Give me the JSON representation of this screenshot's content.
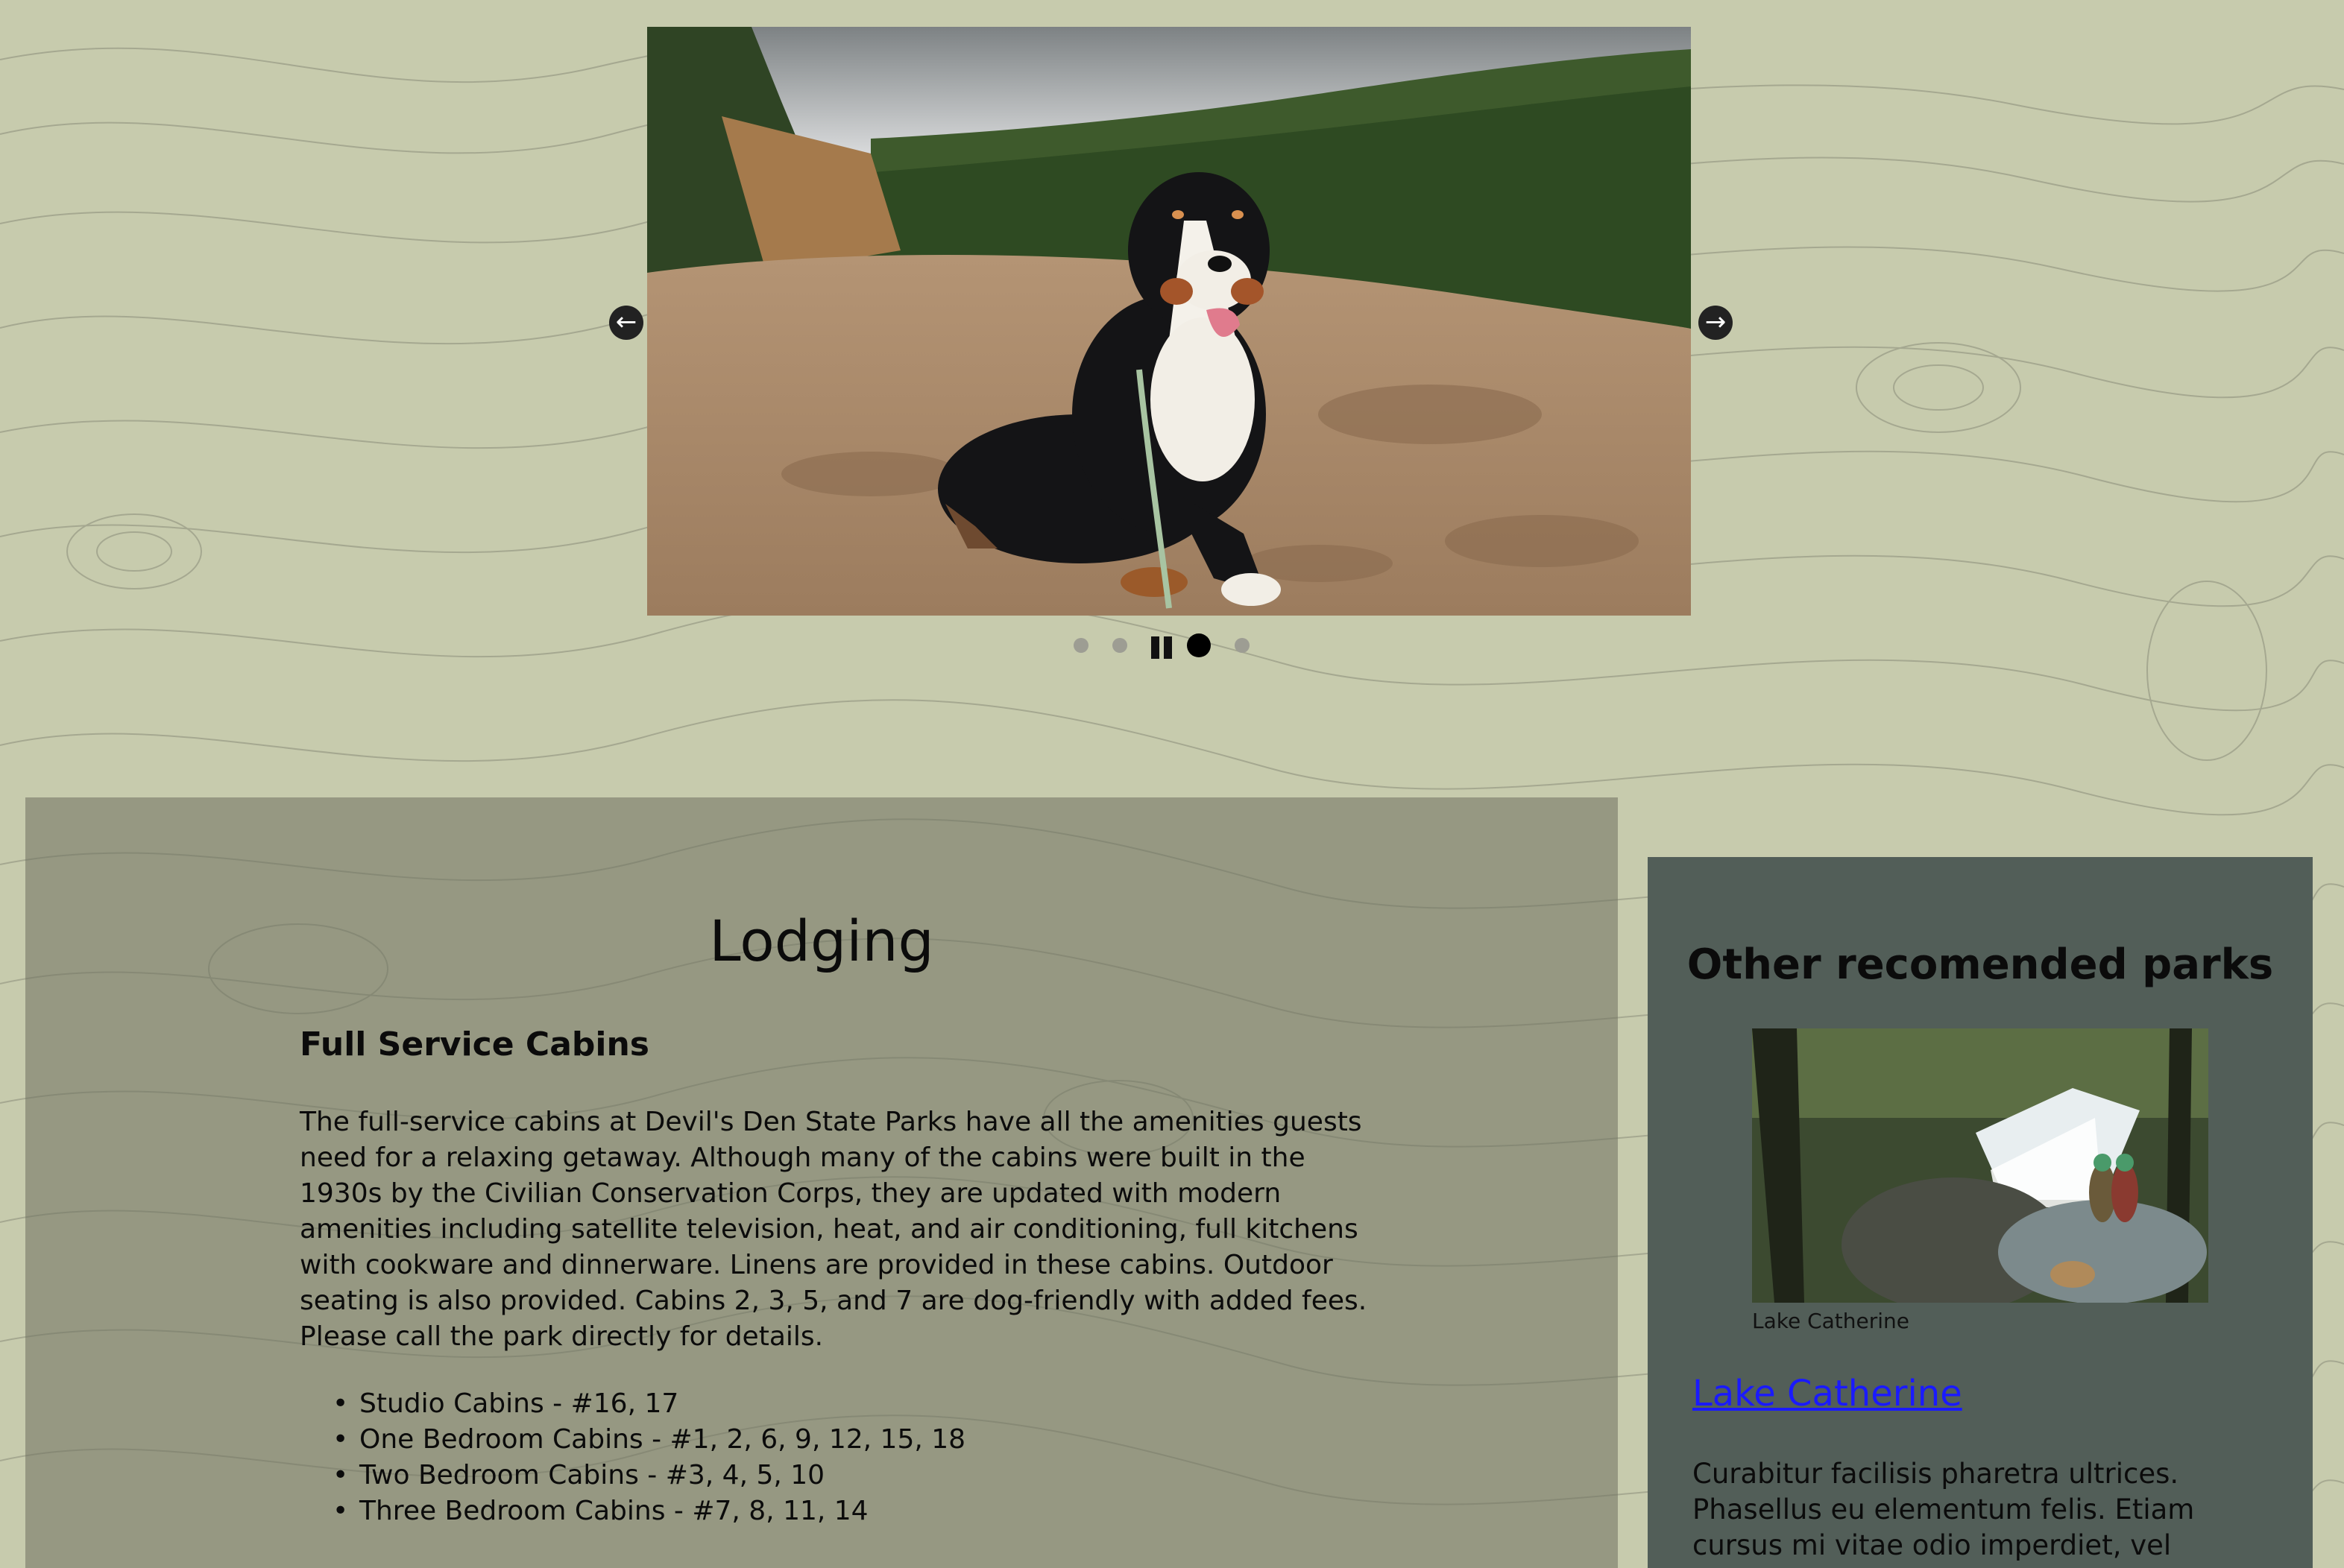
{
  "carousel": {
    "prev_label": "←",
    "next_label": "→",
    "current_slide": 3,
    "slide_count": 4,
    "image_icon": "mountain-dog-photo"
  },
  "main": {
    "title": "Lodging",
    "section_heading": "Full Service Cabins",
    "paragraph": "The full-service cabins at Devil's Den State Parks have all the amenities guests need for a relaxing getaway. Although many of the cabins were built in the 1930s by the Civilian Conservation Corps, they are updated with modern amenities including satellite television, heat, and air conditioning, full kitchens with cookware and dinnerware. Linens are provided in these cabins. Outdoor seating is also provided. Cabins 2, 3, 5, and 7 are dog-friendly with added fees. Please call the park directly for details.",
    "cabins": [
      "Studio Cabins - #16, 17",
      "One Bedroom Cabins - #1, 2, 6, 9, 12, 15, 18",
      "Two Bedroom Cabins - #3, 4, 5, 10",
      "Three Bedroom Cabins - #7, 8, 11, 14"
    ]
  },
  "sidebar": {
    "title": "Other recomended parks",
    "photo_caption": "Lake Catherine",
    "park_link": "Lake Catherine",
    "description": "Curabitur facilisis pharetra ultrices. Phasellus eu elementum felis. Etiam cursus mi vitae odio imperdiet, vel fringilla orci"
  },
  "colors": {
    "page_bg": "#c7cbad",
    "main_panel": "#8a8c78",
    "side_panel": "#525e58",
    "link": "#1a1aff"
  }
}
